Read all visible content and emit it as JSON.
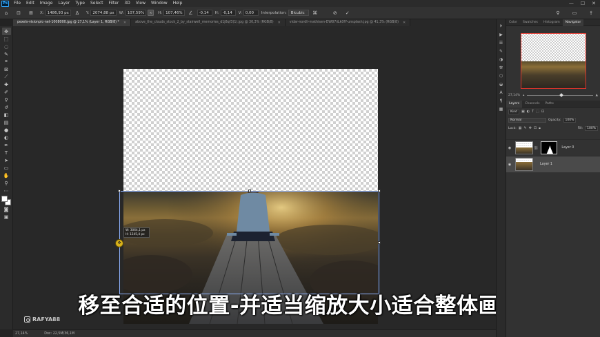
{
  "menubar": {
    "app_logo": "Ps",
    "items": [
      "File",
      "Edit",
      "Image",
      "Layer",
      "Type",
      "Select",
      "Filter",
      "3D",
      "View",
      "Window",
      "Help"
    ],
    "window_controls": [
      "—",
      "☐",
      "✕"
    ]
  },
  "options_bar": {
    "x_label": "X:",
    "x_value": "1486,93 px",
    "y_label": "Y:",
    "y_value": "2074,88 px",
    "w_label": "W:",
    "w_value": "107,59%",
    "h_label": "H:",
    "h_value": "107,46%",
    "angle_value": "-0,14",
    "hskew_label": "H:",
    "hskew_value": "-0,14",
    "vskew_label": "V:",
    "vskew_value": "0,00",
    "interpolation_label": "Interpolation:",
    "interpolation_value": "Bicubic"
  },
  "tabs": [
    {
      "label": "pexels-visionpic-net-1008000.jpg @ 27,1% (Layer 1, RGB/8) *",
      "active": true
    },
    {
      "label": "above_the_clouds_stock_2_by_stairwell_memories_d1j8qf3(1).jpg @ 30,3% (RGB/8)",
      "active": false
    },
    {
      "label": "vidar-nordli-mathisen-DW87iiLk0fY-unsplash.jpg @ 41,3% (RGB/8)",
      "active": false
    }
  ],
  "canvas": {
    "tooltip_w": "W: 3064,1 px",
    "tooltip_h": "H: 1245,4 px"
  },
  "subtitle": "移至合适的位置-并适当缩放大小适合整体画面",
  "watermark": "RAFYA88",
  "statusbar": {
    "zoom": "27,14%",
    "doc": "Doc: 22,5M/36,1M"
  },
  "top_panel": {
    "tabs": [
      "Color",
      "Swatches",
      "Histogram",
      "Navigator"
    ],
    "active_tab": "Navigator",
    "zoom": "27,14%"
  },
  "layers_panel": {
    "tabs": [
      "Layers",
      "Channels",
      "Paths"
    ],
    "active_tab": "Layers",
    "filter_placeholder": "Kind",
    "blend_mode": "Normal",
    "opacity_label": "Opacity:",
    "opacity_value": "100%",
    "lock_label": "Lock:",
    "fill_label": "Fill:",
    "fill_value": "100%",
    "layers": [
      {
        "name": "Layer 0",
        "selected": false,
        "has_mask": true
      },
      {
        "name": "Layer 1",
        "selected": true,
        "has_mask": false
      }
    ]
  },
  "colors": {
    "accent_selection": "#8fb3ff",
    "navigator_frame": "#e0352c",
    "cursor_yellow": "#d9b21a"
  }
}
